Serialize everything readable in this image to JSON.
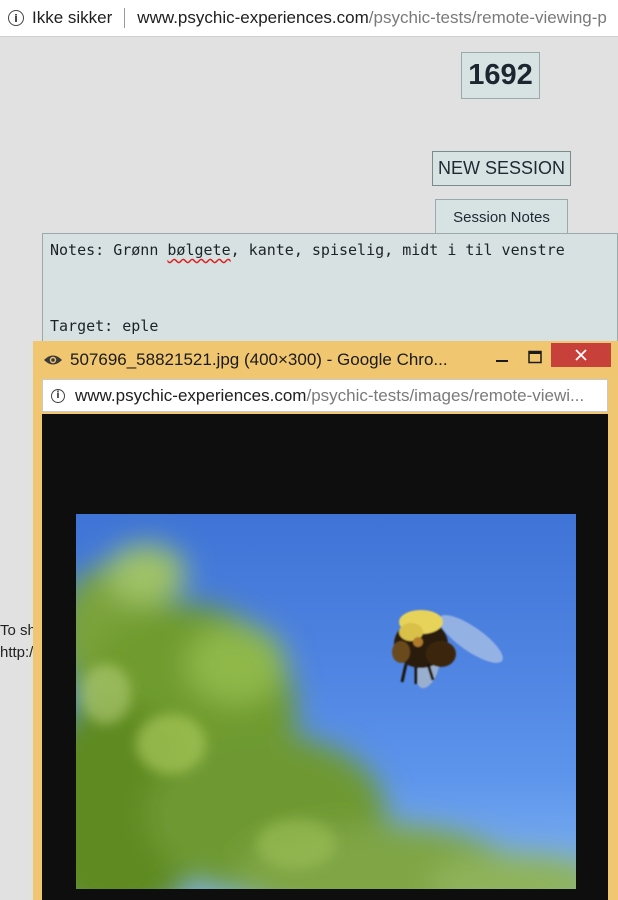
{
  "browser": {
    "security_label": "Ikke sikker",
    "url_host": "www.psychic-experiences.com",
    "url_path": "/psychic-tests/remote-viewing-p"
  },
  "session": {
    "counter": "1692",
    "new_session_label": "NEW SESSION",
    "notes_tab_label": "Session Notes",
    "notes_prefix": "Notes: Grønn ",
    "notes_misspelled": "bølgete",
    "notes_suffix": ", kante, spiselig, midt i til venstre",
    "target_line": "Target: eple"
  },
  "background_text": {
    "line1": "To sh",
    "line2": "http:/"
  },
  "popup": {
    "title": "507696_58821521.jpg (400×300) - Google Chro...",
    "url_host": "www.psychic-experiences.com",
    "url_path": "/psychic-tests/images/remote-viewi..."
  },
  "colors": {
    "popup_frame": "#f0c670",
    "close_button": "#c8403a",
    "panel": "#d7e3e3"
  },
  "icons": [
    "info-icon",
    "eye-icon",
    "minimize-icon",
    "maximize-icon",
    "close-icon"
  ]
}
